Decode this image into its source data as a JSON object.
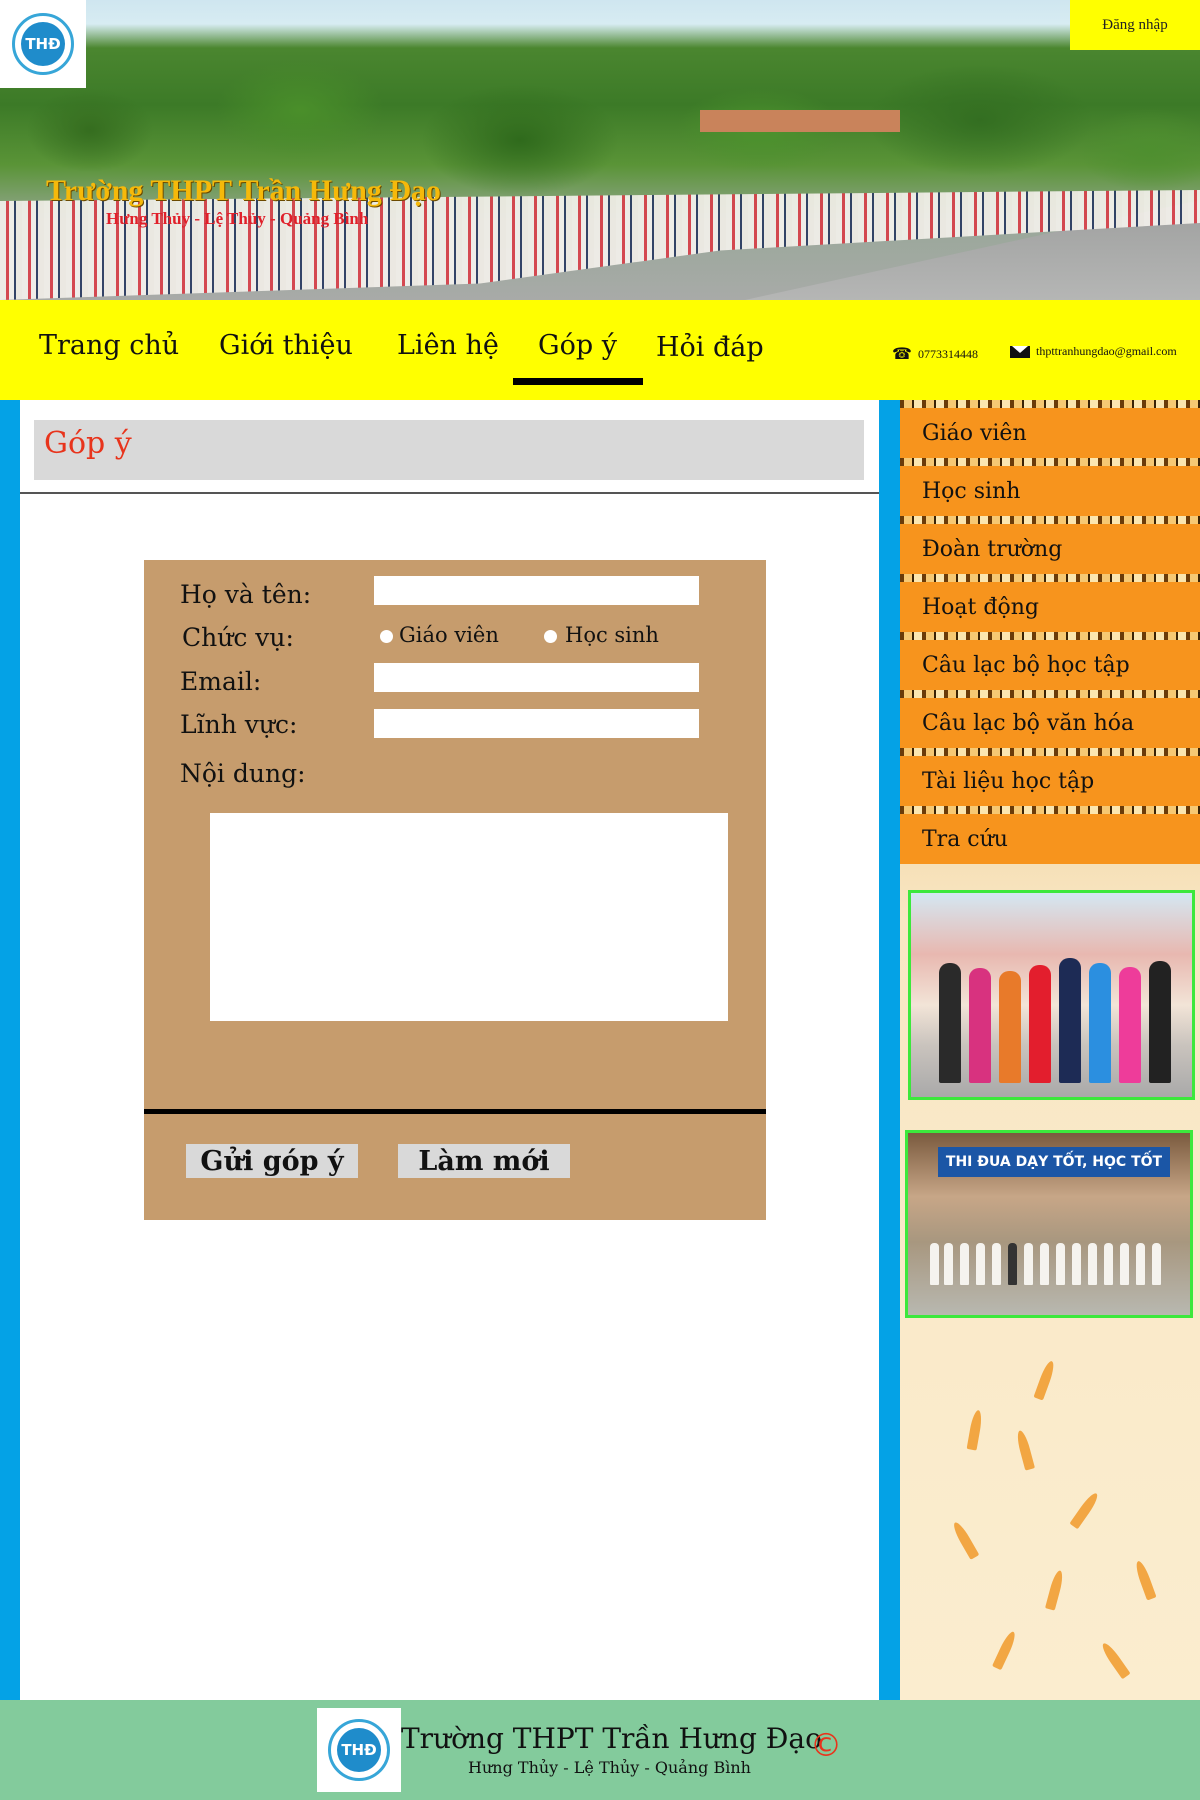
{
  "header": {
    "school_name": "Trường THPT Trần Hưng Đạo",
    "location": "Hưng Thủy - Lệ Thủy - Quảng Bình",
    "login_label": "Đăng nhập",
    "logo_text": "THĐ"
  },
  "nav": {
    "items": [
      "Trang chủ",
      "Giới thiệu",
      "Liên hệ",
      "Góp ý",
      "Hỏi đáp"
    ],
    "active": "Góp ý",
    "phone": "0773314448",
    "email": "thpttranhungdao@gmail.com"
  },
  "main": {
    "title": "Góp ý"
  },
  "form": {
    "name_label": "Họ và tên:",
    "role_label": "Chức vụ:",
    "role_options": [
      "Giáo viên",
      "Học sinh"
    ],
    "email_label": "Email:",
    "field_label": "Lĩnh vực:",
    "content_label": "Nội dung:",
    "submit_label": "Gửi góp ý",
    "reset_label": "Làm mới",
    "name_value": "",
    "email_value": "",
    "field_value": "",
    "content_value": ""
  },
  "sidebar": {
    "items": [
      "Giáo viên",
      "Học sinh",
      "Đoàn trường",
      "Hoạt động",
      "Câu lạc bộ học tập",
      "Câu lạc bộ văn hóa",
      "Tài liệu học tập",
      "Tra cứu"
    ],
    "photo2_sign": "THI ĐUA DẠY TỐT, HỌC TỐT"
  },
  "footer": {
    "school_name": "Trường THPT Trần Hưng Đạo",
    "location": "Hưng Thủy - Lệ Thủy - Quảng Bình",
    "copyright_symbol": "©"
  },
  "colors": {
    "nav_bg": "#ffff00",
    "side_strip": "#04a2e6",
    "form_bg": "#c69c6d",
    "menu_item": "#f7941d",
    "footer_bg": "#83cb9c",
    "title_red": "#e8341c"
  }
}
